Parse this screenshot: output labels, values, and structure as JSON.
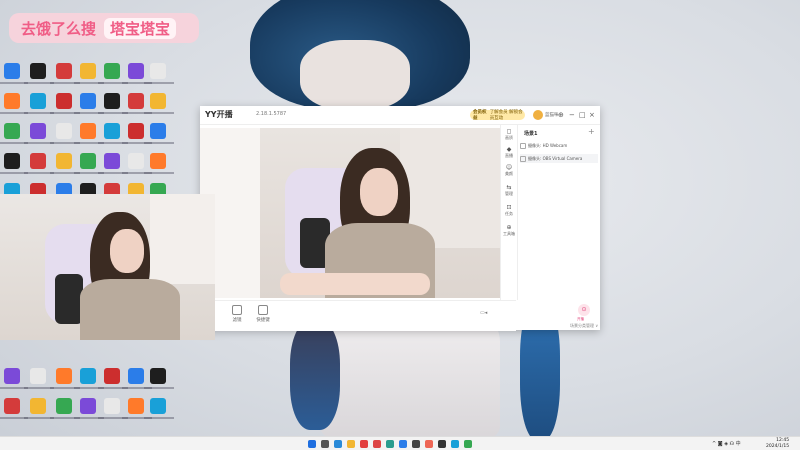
{
  "banner": {
    "text1": "去饿了么搜",
    "text2": "塔宝塔宝"
  },
  "yy_window": {
    "logo": "YY开播",
    "version": "2.18.1.5787",
    "vip": {
      "label": "会员权益",
      "text": "了解会员 解锁会员互动"
    },
    "user": "蓝猫咪",
    "controls": [
      "⊕",
      "−",
      "□",
      "×"
    ],
    "bottom_tools": [
      {
        "label": "滤镜"
      },
      {
        "label": "快捷键"
      }
    ],
    "side_nav": [
      {
        "icon": "◻",
        "label": "画质"
      },
      {
        "icon": "◆",
        "label": "直播"
      },
      {
        "icon": "☺",
        "label": "美颜"
      },
      {
        "icon": "⇆",
        "label": "管理"
      },
      {
        "icon": "⊡",
        "label": "任务"
      },
      {
        "icon": "⊕",
        "label": "工具箱"
      }
    ],
    "panel": {
      "title": "场景1",
      "add": "+",
      "items": [
        "摄像头: HD Webcam",
        "摄像头: OBS Virtual Camera"
      ],
      "button_label": "开播",
      "footer": "场景分类管理 ∨"
    }
  },
  "taskbar": {
    "tray": "^ ◙ ◈ ☊ 中",
    "time": "12:45",
    "date": "2024/1/15"
  }
}
